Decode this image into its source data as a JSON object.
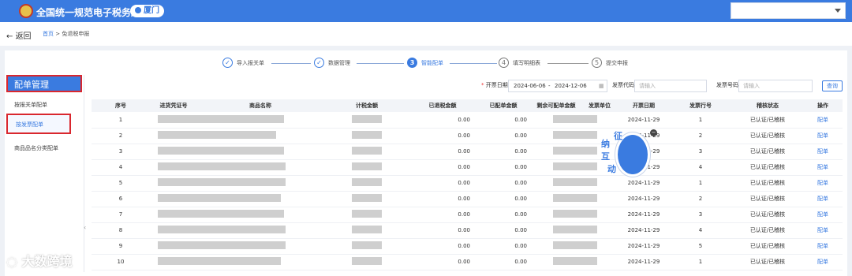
{
  "topbar": {
    "title": "全国统一规范电子税务局",
    "city": "厦门"
  },
  "subbar": {
    "back": "返回",
    "breadcrumb_home": "首页",
    "breadcrumb_sep": ">",
    "breadcrumb_current": "免退税申报"
  },
  "steps": [
    {
      "num": "✓",
      "label": "导入报关单",
      "state": "done"
    },
    {
      "num": "✓",
      "label": "数据管理",
      "state": "done"
    },
    {
      "num": "3",
      "label": "智能配单",
      "state": "active"
    },
    {
      "num": "4",
      "label": "填写明细表",
      "state": "todo"
    },
    {
      "num": "5",
      "label": "提交申报",
      "state": "todo"
    }
  ],
  "sidebar": {
    "title": "配单管理",
    "items": [
      {
        "label": "按报关单配单"
      },
      {
        "label": "按发票配单"
      },
      {
        "label": "商品品名分类配单"
      }
    ]
  },
  "filters": {
    "date_label": "开票日期",
    "date_start": "2024-06-06",
    "date_sep": "-",
    "date_end": "2024-12-06",
    "invoice_code_label": "发票代码",
    "invoice_code_placeholder": "请输入",
    "invoice_no_label": "发票号码",
    "invoice_no_placeholder": "请输入",
    "query": "查询"
  },
  "table": {
    "headers": [
      "序号",
      "进货凭证号",
      "商品名称",
      "计税金额",
      "已退税金额",
      "已配单金额",
      "剩余可配单金额",
      "发票单位",
      "开票日期",
      "发票行号",
      "稽核状态",
      "操作"
    ],
    "rows": [
      {
        "no": "1",
        "refund": "0.00",
        "matched": "0.00",
        "date": "2024-11-29",
        "line": "1",
        "status": "已认证/已稽核",
        "action": "配单"
      },
      {
        "no": "2",
        "refund": "0.00",
        "matched": "0.00",
        "date": "2024-11-29",
        "line": "2",
        "status": "已认证/已稽核",
        "action": "配单"
      },
      {
        "no": "3",
        "refund": "0.00",
        "matched": "0.00",
        "date": "2024-11-29",
        "line": "3",
        "status": "已认证/已稽核",
        "action": "配单"
      },
      {
        "no": "4",
        "refund": "0.00",
        "matched": "0.00",
        "date": "2024-11-29",
        "line": "4",
        "status": "已认证/已稽核",
        "action": "配单"
      },
      {
        "no": "5",
        "refund": "0.00",
        "matched": "0.00",
        "date": "2024-11-29",
        "line": "1",
        "status": "已认证/已稽核",
        "action": "配单"
      },
      {
        "no": "6",
        "refund": "0.00",
        "matched": "0.00",
        "date": "2024-11-29",
        "line": "2",
        "status": "已认证/已稽核",
        "action": "配单"
      },
      {
        "no": "7",
        "refund": "0.00",
        "matched": "0.00",
        "date": "2024-11-29",
        "line": "3",
        "status": "已认证/已稽核",
        "action": "配单"
      },
      {
        "no": "8",
        "refund": "0.00",
        "matched": "0.00",
        "date": "2024-11-29",
        "line": "4",
        "status": "已认证/已稽核",
        "action": "配单"
      },
      {
        "no": "9",
        "refund": "0.00",
        "matched": "0.00",
        "date": "2024-11-29",
        "line": "5",
        "status": "已认证/已稽核",
        "action": "配单"
      },
      {
        "no": "10",
        "refund": "0.00",
        "matched": "0.00",
        "date": "2024-11-29",
        "line": "1",
        "status": "已认证/已稽核",
        "action": "配单"
      }
    ]
  },
  "mascot": {
    "chars": [
      "征",
      "纳",
      "互",
      "动"
    ]
  },
  "watermark": "大数跨境",
  "colors": {
    "primary": "#3a7be0",
    "highlight": "#d9272e"
  }
}
